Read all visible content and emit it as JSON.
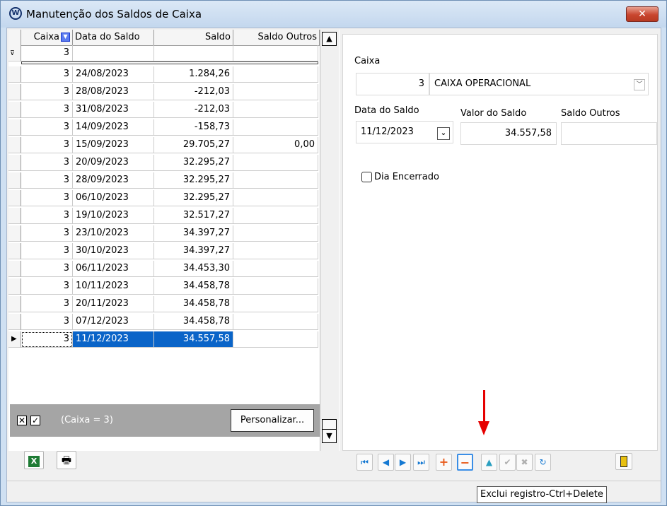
{
  "window": {
    "title": "Manutenção dos Saldos de Caixa",
    "close_glyph": "✕"
  },
  "grid": {
    "columns": [
      "Caixa",
      "Data do Saldo",
      "Saldo",
      "Saldo Outros"
    ],
    "filter_row": {
      "caixa": "3"
    },
    "rows": [
      {
        "caixa": "3",
        "data": "24/08/2023",
        "saldo": "1.284,26",
        "outros": ""
      },
      {
        "caixa": "3",
        "data": "28/08/2023",
        "saldo": "-212,03",
        "outros": ""
      },
      {
        "caixa": "3",
        "data": "31/08/2023",
        "saldo": "-212,03",
        "outros": ""
      },
      {
        "caixa": "3",
        "data": "14/09/2023",
        "saldo": "-158,73",
        "outros": ""
      },
      {
        "caixa": "3",
        "data": "15/09/2023",
        "saldo": "29.705,27",
        "outros": "0,00"
      },
      {
        "caixa": "3",
        "data": "20/09/2023",
        "saldo": "32.295,27",
        "outros": ""
      },
      {
        "caixa": "3",
        "data": "28/09/2023",
        "saldo": "32.295,27",
        "outros": ""
      },
      {
        "caixa": "3",
        "data": "06/10/2023",
        "saldo": "32.295,27",
        "outros": ""
      },
      {
        "caixa": "3",
        "data": "19/10/2023",
        "saldo": "32.517,27",
        "outros": ""
      },
      {
        "caixa": "3",
        "data": "23/10/2023",
        "saldo": "34.397,27",
        "outros": ""
      },
      {
        "caixa": "3",
        "data": "30/10/2023",
        "saldo": "34.397,27",
        "outros": ""
      },
      {
        "caixa": "3",
        "data": "06/11/2023",
        "saldo": "34.453,30",
        "outros": ""
      },
      {
        "caixa": "3",
        "data": "10/11/2023",
        "saldo": "34.458,78",
        "outros": ""
      },
      {
        "caixa": "3",
        "data": "20/11/2023",
        "saldo": "34.458,78",
        "outros": ""
      },
      {
        "caixa": "3",
        "data": "07/12/2023",
        "saldo": "34.458,78",
        "outros": ""
      },
      {
        "caixa": "3",
        "data": "11/12/2023",
        "saldo": "34.557,58",
        "outros": ""
      }
    ],
    "selected_index": 15,
    "filter_bar": {
      "text": "(Caixa = 3)",
      "customize_label": "Personalizar..."
    }
  },
  "form": {
    "caixa_label": "Caixa",
    "caixa_code": "3",
    "caixa_name": "CAIXA OPERACIONAL",
    "data_label": "Data do Saldo",
    "data_value": "11/12/2023",
    "valor_label": "Valor do Saldo",
    "valor_value": "34.557,58",
    "outros_label": "Saldo Outros",
    "outros_value": "",
    "encerrado_label": "Dia Encerrado"
  },
  "tooltip": "Exclui registro-Ctrl+Delete",
  "colors": {
    "selection": "#0a64c8",
    "arrow": "#e60000",
    "accent": "#1478d2"
  }
}
